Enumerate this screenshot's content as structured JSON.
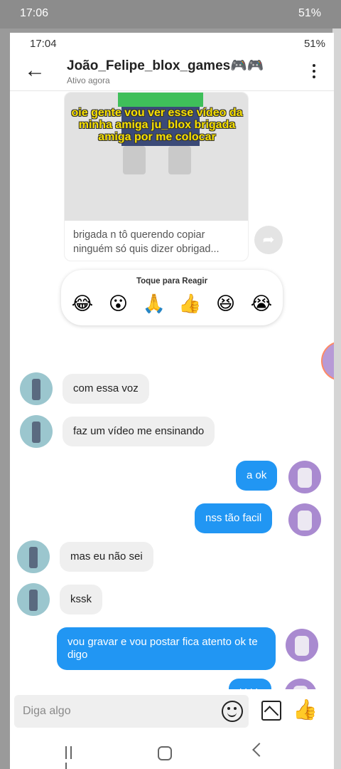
{
  "outer_status": {
    "time": "17:06",
    "battery": "51%"
  },
  "status": {
    "time": "17:04",
    "battery": "51%"
  },
  "header": {
    "name": "João_Felipe_blox_games🎮🎮",
    "presence": "Ativo agora"
  },
  "shared_post": {
    "overlay_text": "oie gente vou ver esse vídeo da minha amiga ju_blox brigada amiga por me colocar",
    "caption": "brigada n tô querendo copiar ninguém só quis dizer obrigad..."
  },
  "reactions": {
    "title": "Toque para Reagir",
    "emojis": [
      "😂",
      "😮",
      "🙏",
      "👍",
      "😆",
      "😭"
    ]
  },
  "messages": [
    {
      "side": "in",
      "text": "com essa voz"
    },
    {
      "side": "in",
      "text": "faz um vídeo me ensinando"
    },
    {
      "side": "out",
      "text": "a ok"
    },
    {
      "side": "out",
      "text": "nss tão facil"
    },
    {
      "side": "in",
      "text": "mas eu não sei"
    },
    {
      "side": "in",
      "text": "kssk"
    },
    {
      "side": "out",
      "text": "vou gravar e vou postar fica atento ok te digo"
    },
    {
      "side": "out",
      "text": "kkkk"
    }
  ],
  "composer": {
    "placeholder": "Diga algo"
  },
  "colors": {
    "outgoing_bubble": "#2196f3",
    "incoming_bubble": "#efefef"
  },
  "icons": [
    "back-arrow-icon",
    "more-vertical-icon",
    "share-icon",
    "emoji-icon",
    "image-icon",
    "thumbs-up-icon",
    "recent-apps-icon",
    "home-icon",
    "back-nav-icon"
  ]
}
